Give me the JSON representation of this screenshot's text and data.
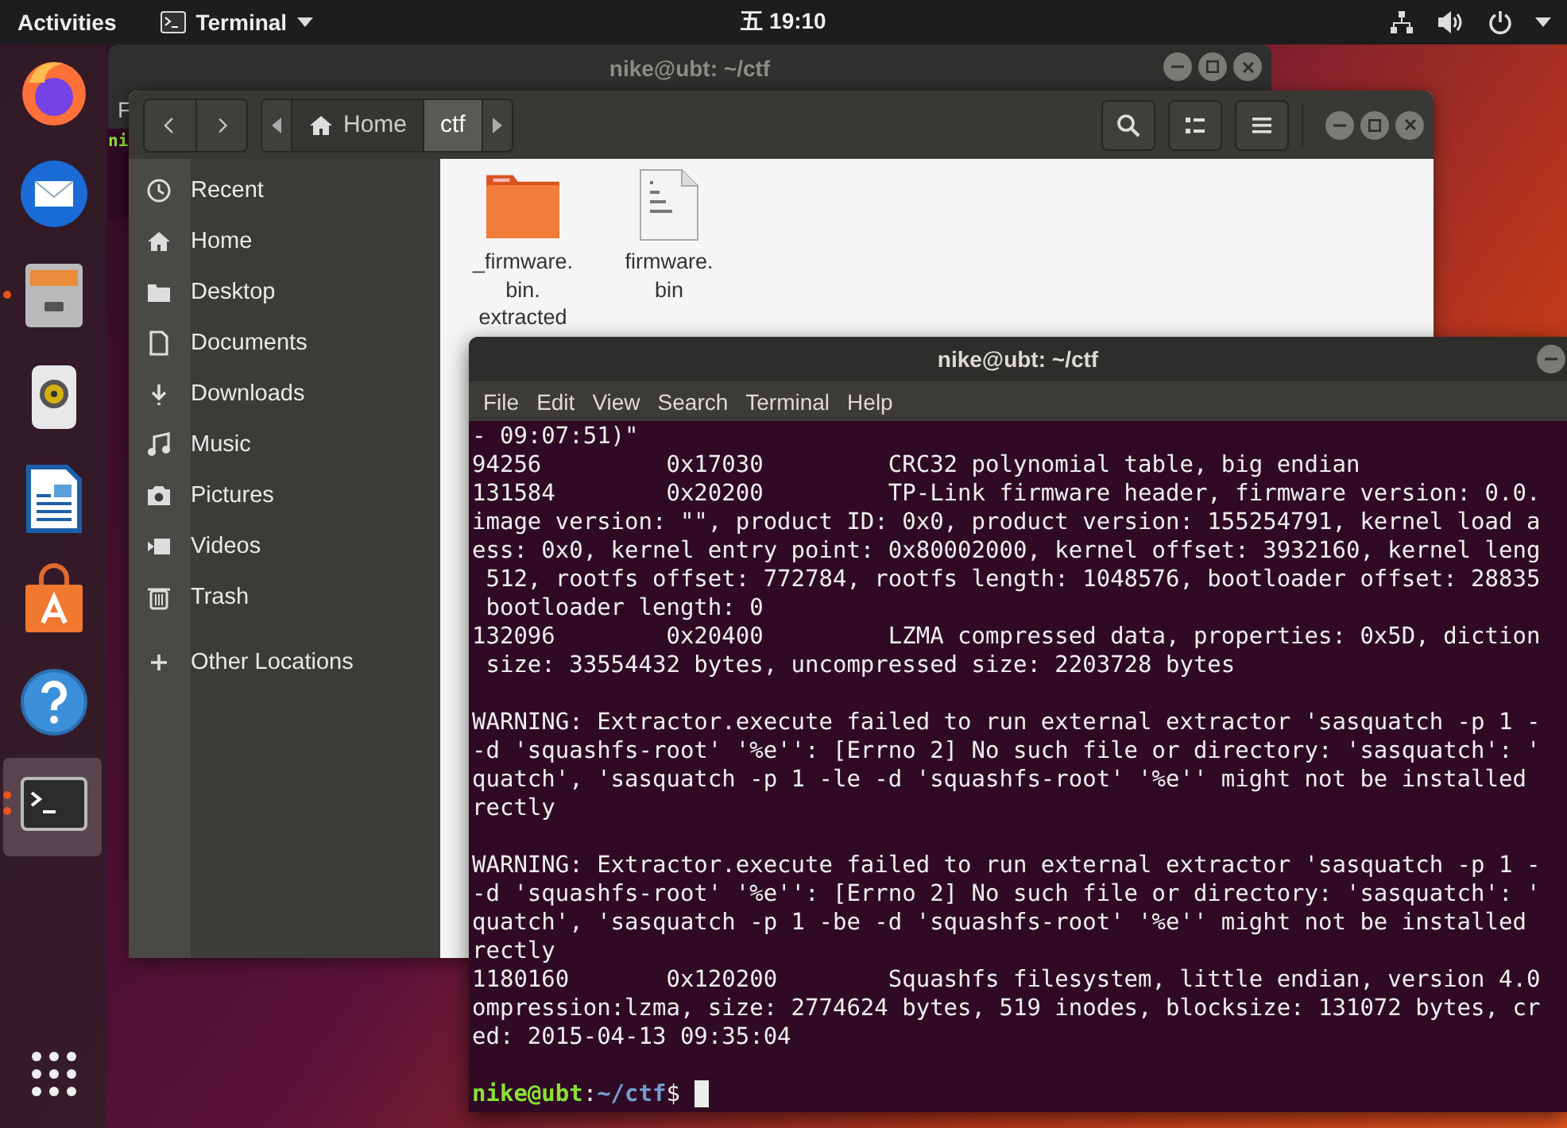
{
  "top_bar": {
    "activities": "Activities",
    "app_menu": "Terminal",
    "clock": "五 19:10"
  },
  "dock": {
    "items": [
      {
        "kind": "firefox",
        "running": false,
        "active": false
      },
      {
        "kind": "mail",
        "running": false,
        "active": false
      },
      {
        "kind": "files",
        "running": true,
        "multiple_windows": false,
        "active": false
      },
      {
        "kind": "speaker",
        "running": false,
        "active": false
      },
      {
        "kind": "writer",
        "running": false,
        "active": false
      },
      {
        "kind": "store",
        "running": false,
        "active": false
      },
      {
        "kind": "help",
        "running": false,
        "active": false
      },
      {
        "kind": "terminal",
        "running": true,
        "multiple_windows": true,
        "active": true
      }
    ],
    "grid": true
  },
  "background_window": {
    "title": "nike@ubt: ~/ctf",
    "menu_peek": "F",
    "prompt_peek": "ni"
  },
  "files_window": {
    "path": [
      {
        "label": "Home",
        "kind": "home",
        "selected": false
      },
      {
        "label": "ctf",
        "kind": "plain",
        "selected": true
      }
    ],
    "sidebar": [
      {
        "label": "Recent",
        "kind": "recent"
      },
      {
        "label": "Home",
        "kind": "home"
      },
      {
        "label": "Desktop",
        "kind": "desktop"
      },
      {
        "label": "Documents",
        "kind": "documents"
      },
      {
        "label": "Downloads",
        "kind": "downloads"
      },
      {
        "label": "Music",
        "kind": "music"
      },
      {
        "label": "Pictures",
        "kind": "pictures"
      },
      {
        "label": "Videos",
        "kind": "videos"
      },
      {
        "label": "Trash",
        "kind": "trash"
      },
      {
        "label": "Other Locations",
        "kind": "other"
      }
    ],
    "files": [
      {
        "name": "_firmware.bin.extracted",
        "kind": "folder"
      },
      {
        "name": "firmware.bin",
        "kind": "binary"
      }
    ]
  },
  "terminal": {
    "title": "nike@ubt: ~/ctf",
    "menu": [
      "File",
      "Edit",
      "View",
      "Search",
      "Terminal",
      "Help"
    ],
    "lines": [
      {
        "kind": "text",
        "text": "- 09:07:51)\""
      },
      {
        "kind": "text",
        "text": "94256         0x17030         CRC32 polynomial table, big endian"
      },
      {
        "kind": "text",
        "text": "131584        0x20200         TP-Link firmware header, firmware version: 0.0."
      },
      {
        "kind": "text",
        "text": "image version: \"\", product ID: 0x0, product version: 155254791, kernel load a"
      },
      {
        "kind": "text",
        "text": "ess: 0x0, kernel entry point: 0x80002000, kernel offset: 3932160, kernel leng"
      },
      {
        "kind": "text",
        "text": " 512, rootfs offset: 772784, rootfs length: 1048576, bootloader offset: 28835"
      },
      {
        "kind": "text",
        "text": " bootloader length: 0"
      },
      {
        "kind": "text",
        "text": "132096        0x20400         LZMA compressed data, properties: 0x5D, diction"
      },
      {
        "kind": "text",
        "text": " size: 33554432 bytes, uncompressed size: 2203728 bytes"
      },
      {
        "kind": "blank"
      },
      {
        "kind": "text",
        "text": "WARNING: Extractor.execute failed to run external extractor 'sasquatch -p 1 -"
      },
      {
        "kind": "text",
        "text": "-d 'squashfs-root' '%e'': [Errno 2] No such file or directory: 'sasquatch': '"
      },
      {
        "kind": "text",
        "text": "quatch', 'sasquatch -p 1 -le -d 'squashfs-root' '%e'' might not be installed"
      },
      {
        "kind": "text",
        "text": "rectly"
      },
      {
        "kind": "blank"
      },
      {
        "kind": "text",
        "text": "WARNING: Extractor.execute failed to run external extractor 'sasquatch -p 1 -"
      },
      {
        "kind": "text",
        "text": "-d 'squashfs-root' '%e'': [Errno 2] No such file or directory: 'sasquatch': '"
      },
      {
        "kind": "text",
        "text": "quatch', 'sasquatch -p 1 -be -d 'squashfs-root' '%e'' might not be installed"
      },
      {
        "kind": "text",
        "text": "rectly"
      },
      {
        "kind": "text",
        "text": "1180160       0x120200        Squashfs filesystem, little endian, version 4.0"
      },
      {
        "kind": "text",
        "text": "ompression:lzma, size: 2774624 bytes, 519 inodes, blocksize: 131072 bytes, cr"
      },
      {
        "kind": "text",
        "text": "ed: 2015-04-13 09:35:04"
      },
      {
        "kind": "blank"
      }
    ],
    "prompt": {
      "user": "nike@ubt",
      "separator": ":",
      "path": "~/ctf",
      "symbol": "$"
    }
  }
}
